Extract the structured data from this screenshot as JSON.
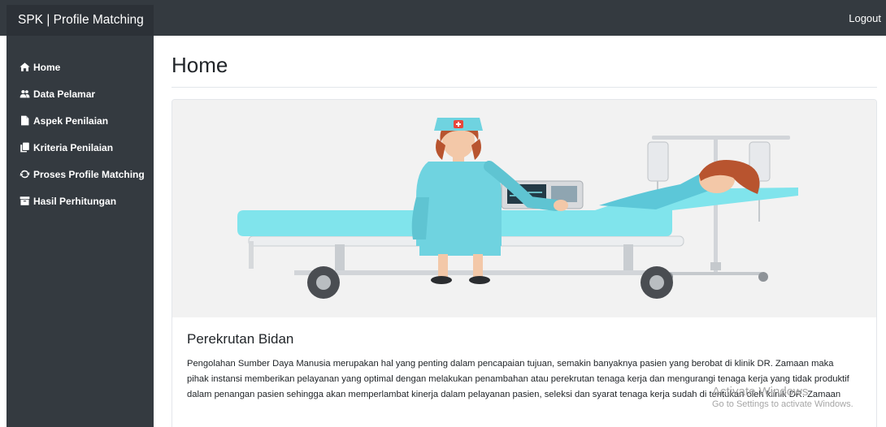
{
  "brand": "SPK | Profile Matching",
  "topbar": {
    "logout_label": "Logout"
  },
  "sidebar": {
    "items": [
      {
        "label": "Home",
        "icon": "home-icon"
      },
      {
        "label": "Data Pelamar",
        "icon": "users-icon"
      },
      {
        "label": "Aspek Penilaian",
        "icon": "file-icon"
      },
      {
        "label": "Kriteria Penilaian",
        "icon": "copy-icon"
      },
      {
        "label": "Proses Profile Matching",
        "icon": "sync-icon"
      },
      {
        "label": "Hasil Perhitungan",
        "icon": "archive-icon"
      }
    ]
  },
  "main": {
    "title": "Home",
    "card": {
      "image_icon": "nurse-hospital-bed-illustration",
      "title": "Perekrutan Bidan",
      "text": "Pengolahan Sumber Daya Manusia merupakan hal yang penting dalam pencapaian tujuan, semakin banyaknya pasien yang berobat di klinik DR. Zamaan maka pihak instansi memberikan pelayanan yang optimal dengan melakukan penambahan atau perekrutan tenaga kerja dan mengurangi tenaga kerja yang tidak produktif dalam penangan pasien sehingga akan memperlambat kinerja dalam pelayanan pasien, seleksi dan syarat tenaga kerja sudah di tentukan oleh klinik DR. Zamaan"
    }
  },
  "watermark": {
    "line1": "Activate Windows",
    "line2": "Go to Settings to activate Windows."
  },
  "colors": {
    "navbar": "#343a40",
    "brand_bg": "#2c3137",
    "image_bg": "#f2f2f2",
    "bed_teal": "#7fe3ea",
    "scrubs": "#6fd3e0"
  }
}
